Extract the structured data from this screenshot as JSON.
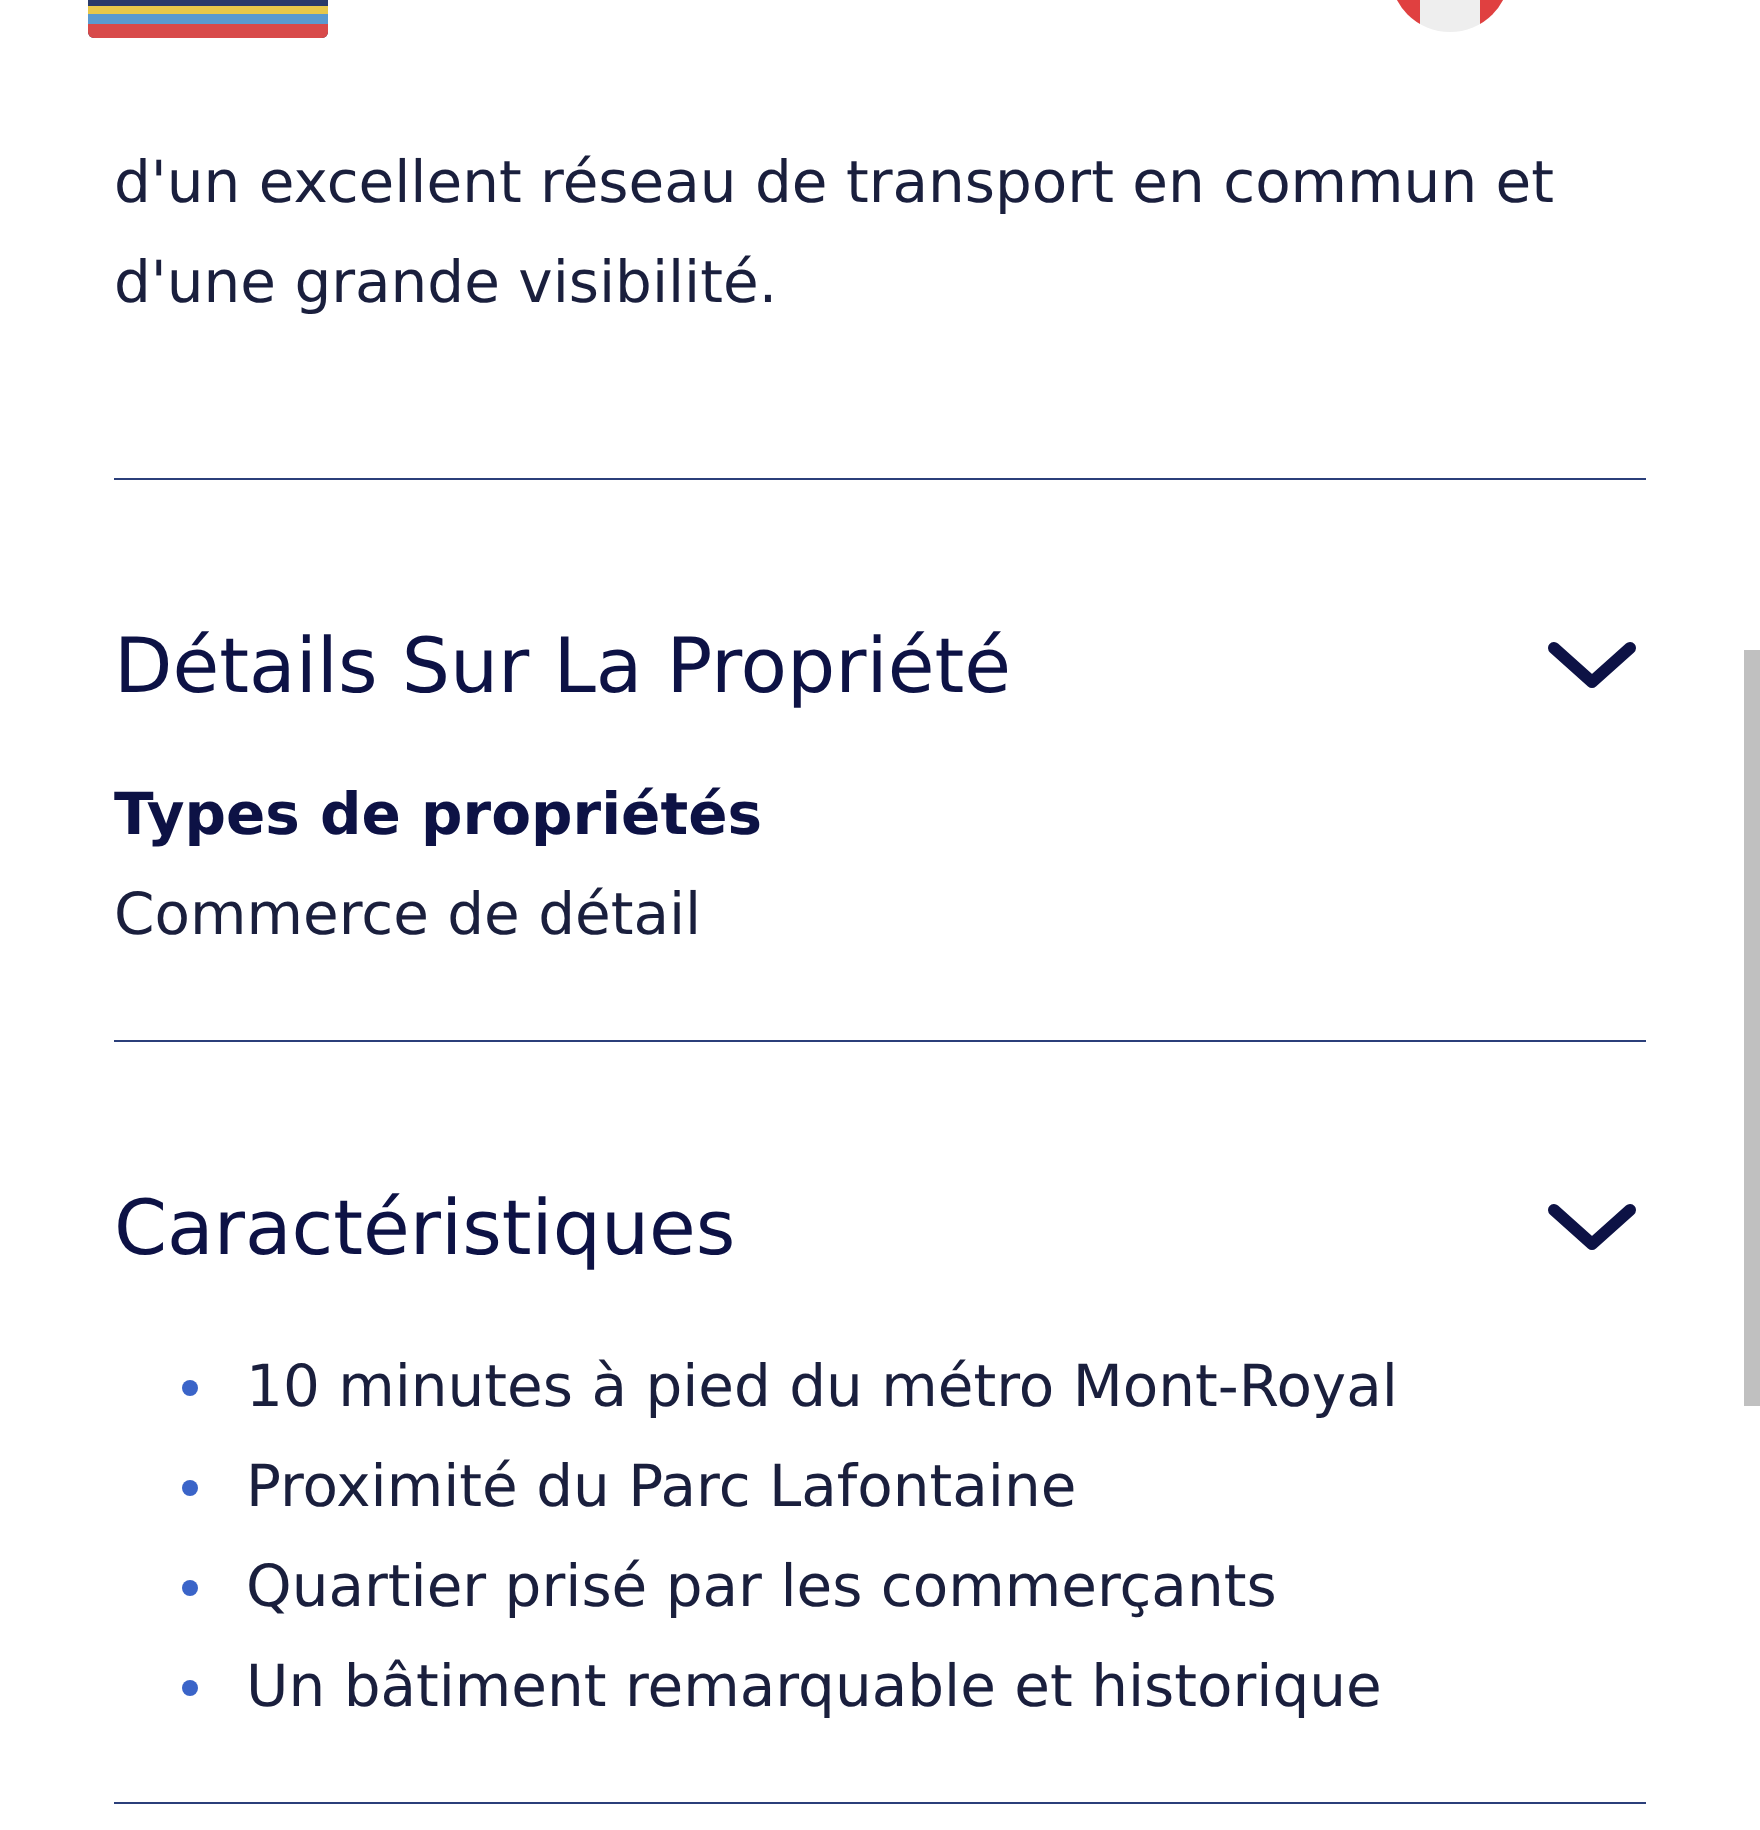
{
  "intro": {
    "text": "d'un excellent réseau de transport en commun et d'une grande visibilité."
  },
  "sections": [
    {
      "title": "Détails Sur La Propriété",
      "expanded": true,
      "kind": "fields",
      "fields": [
        {
          "label": "Types de propriétés",
          "value": "Commerce de détail"
        }
      ]
    },
    {
      "title": "Caractéristiques",
      "expanded": true,
      "kind": "bullets",
      "items": [
        "10 minutes à pied du métro Mont-Royal",
        "Proximité du Parc Lafontaine",
        "Quartier prisé par les commerçants",
        "Un bâtiment remarquable et historique"
      ]
    }
  ]
}
